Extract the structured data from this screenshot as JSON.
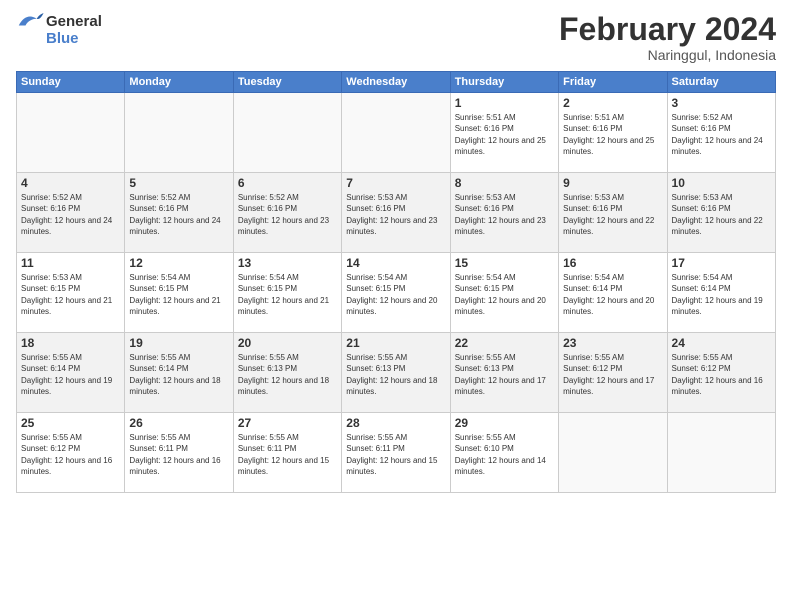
{
  "header": {
    "month": "February 2024",
    "location": "Naringgul, Indonesia",
    "logo_general": "General",
    "logo_blue": "Blue"
  },
  "weekdays": [
    "Sunday",
    "Monday",
    "Tuesday",
    "Wednesday",
    "Thursday",
    "Friday",
    "Saturday"
  ],
  "weeks": [
    [
      {
        "day": "",
        "sunrise": "",
        "sunset": "",
        "daylight": "",
        "empty": true
      },
      {
        "day": "",
        "sunrise": "",
        "sunset": "",
        "daylight": "",
        "empty": true
      },
      {
        "day": "",
        "sunrise": "",
        "sunset": "",
        "daylight": "",
        "empty": true
      },
      {
        "day": "",
        "sunrise": "",
        "sunset": "",
        "daylight": "",
        "empty": true
      },
      {
        "day": "1",
        "sunrise": "Sunrise: 5:51 AM",
        "sunset": "Sunset: 6:16 PM",
        "daylight": "Daylight: 12 hours and 25 minutes.",
        "empty": false
      },
      {
        "day": "2",
        "sunrise": "Sunrise: 5:51 AM",
        "sunset": "Sunset: 6:16 PM",
        "daylight": "Daylight: 12 hours and 25 minutes.",
        "empty": false
      },
      {
        "day": "3",
        "sunrise": "Sunrise: 5:52 AM",
        "sunset": "Sunset: 6:16 PM",
        "daylight": "Daylight: 12 hours and 24 minutes.",
        "empty": false
      }
    ],
    [
      {
        "day": "4",
        "sunrise": "Sunrise: 5:52 AM",
        "sunset": "Sunset: 6:16 PM",
        "daylight": "Daylight: 12 hours and 24 minutes.",
        "empty": false
      },
      {
        "day": "5",
        "sunrise": "Sunrise: 5:52 AM",
        "sunset": "Sunset: 6:16 PM",
        "daylight": "Daylight: 12 hours and 24 minutes.",
        "empty": false
      },
      {
        "day": "6",
        "sunrise": "Sunrise: 5:52 AM",
        "sunset": "Sunset: 6:16 PM",
        "daylight": "Daylight: 12 hours and 23 minutes.",
        "empty": false
      },
      {
        "day": "7",
        "sunrise": "Sunrise: 5:53 AM",
        "sunset": "Sunset: 6:16 PM",
        "daylight": "Daylight: 12 hours and 23 minutes.",
        "empty": false
      },
      {
        "day": "8",
        "sunrise": "Sunrise: 5:53 AM",
        "sunset": "Sunset: 6:16 PM",
        "daylight": "Daylight: 12 hours and 23 minutes.",
        "empty": false
      },
      {
        "day": "9",
        "sunrise": "Sunrise: 5:53 AM",
        "sunset": "Sunset: 6:16 PM",
        "daylight": "Daylight: 12 hours and 22 minutes.",
        "empty": false
      },
      {
        "day": "10",
        "sunrise": "Sunrise: 5:53 AM",
        "sunset": "Sunset: 6:16 PM",
        "daylight": "Daylight: 12 hours and 22 minutes.",
        "empty": false
      }
    ],
    [
      {
        "day": "11",
        "sunrise": "Sunrise: 5:53 AM",
        "sunset": "Sunset: 6:15 PM",
        "daylight": "Daylight: 12 hours and 21 minutes.",
        "empty": false
      },
      {
        "day": "12",
        "sunrise": "Sunrise: 5:54 AM",
        "sunset": "Sunset: 6:15 PM",
        "daylight": "Daylight: 12 hours and 21 minutes.",
        "empty": false
      },
      {
        "day": "13",
        "sunrise": "Sunrise: 5:54 AM",
        "sunset": "Sunset: 6:15 PM",
        "daylight": "Daylight: 12 hours and 21 minutes.",
        "empty": false
      },
      {
        "day": "14",
        "sunrise": "Sunrise: 5:54 AM",
        "sunset": "Sunset: 6:15 PM",
        "daylight": "Daylight: 12 hours and 20 minutes.",
        "empty": false
      },
      {
        "day": "15",
        "sunrise": "Sunrise: 5:54 AM",
        "sunset": "Sunset: 6:15 PM",
        "daylight": "Daylight: 12 hours and 20 minutes.",
        "empty": false
      },
      {
        "day": "16",
        "sunrise": "Sunrise: 5:54 AM",
        "sunset": "Sunset: 6:14 PM",
        "daylight": "Daylight: 12 hours and 20 minutes.",
        "empty": false
      },
      {
        "day": "17",
        "sunrise": "Sunrise: 5:54 AM",
        "sunset": "Sunset: 6:14 PM",
        "daylight": "Daylight: 12 hours and 19 minutes.",
        "empty": false
      }
    ],
    [
      {
        "day": "18",
        "sunrise": "Sunrise: 5:55 AM",
        "sunset": "Sunset: 6:14 PM",
        "daylight": "Daylight: 12 hours and 19 minutes.",
        "empty": false
      },
      {
        "day": "19",
        "sunrise": "Sunrise: 5:55 AM",
        "sunset": "Sunset: 6:14 PM",
        "daylight": "Daylight: 12 hours and 18 minutes.",
        "empty": false
      },
      {
        "day": "20",
        "sunrise": "Sunrise: 5:55 AM",
        "sunset": "Sunset: 6:13 PM",
        "daylight": "Daylight: 12 hours and 18 minutes.",
        "empty": false
      },
      {
        "day": "21",
        "sunrise": "Sunrise: 5:55 AM",
        "sunset": "Sunset: 6:13 PM",
        "daylight": "Daylight: 12 hours and 18 minutes.",
        "empty": false
      },
      {
        "day": "22",
        "sunrise": "Sunrise: 5:55 AM",
        "sunset": "Sunset: 6:13 PM",
        "daylight": "Daylight: 12 hours and 17 minutes.",
        "empty": false
      },
      {
        "day": "23",
        "sunrise": "Sunrise: 5:55 AM",
        "sunset": "Sunset: 6:12 PM",
        "daylight": "Daylight: 12 hours and 17 minutes.",
        "empty": false
      },
      {
        "day": "24",
        "sunrise": "Sunrise: 5:55 AM",
        "sunset": "Sunset: 6:12 PM",
        "daylight": "Daylight: 12 hours and 16 minutes.",
        "empty": false
      }
    ],
    [
      {
        "day": "25",
        "sunrise": "Sunrise: 5:55 AM",
        "sunset": "Sunset: 6:12 PM",
        "daylight": "Daylight: 12 hours and 16 minutes.",
        "empty": false
      },
      {
        "day": "26",
        "sunrise": "Sunrise: 5:55 AM",
        "sunset": "Sunset: 6:11 PM",
        "daylight": "Daylight: 12 hours and 16 minutes.",
        "empty": false
      },
      {
        "day": "27",
        "sunrise": "Sunrise: 5:55 AM",
        "sunset": "Sunset: 6:11 PM",
        "daylight": "Daylight: 12 hours and 15 minutes.",
        "empty": false
      },
      {
        "day": "28",
        "sunrise": "Sunrise: 5:55 AM",
        "sunset": "Sunset: 6:11 PM",
        "daylight": "Daylight: 12 hours and 15 minutes.",
        "empty": false
      },
      {
        "day": "29",
        "sunrise": "Sunrise: 5:55 AM",
        "sunset": "Sunset: 6:10 PM",
        "daylight": "Daylight: 12 hours and 14 minutes.",
        "empty": false
      },
      {
        "day": "",
        "sunrise": "",
        "sunset": "",
        "daylight": "",
        "empty": true
      },
      {
        "day": "",
        "sunrise": "",
        "sunset": "",
        "daylight": "",
        "empty": true
      }
    ]
  ],
  "shaded_rows": [
    1,
    3
  ]
}
